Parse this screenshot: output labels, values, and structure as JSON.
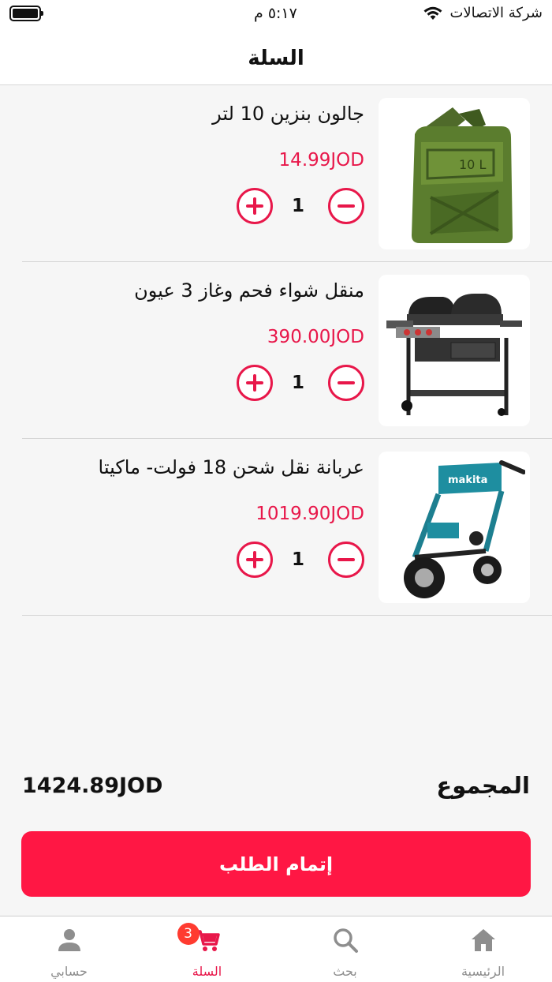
{
  "status_bar": {
    "carrier": "شركة الاتصالات",
    "time": "٥:١٧ م"
  },
  "header": {
    "title": "السلة"
  },
  "cart": {
    "items": [
      {
        "name": "جالون بنزين 10 لتر",
        "price": "14.99JOD",
        "quantity": "1",
        "image": "jerry-can-image"
      },
      {
        "name": "منقل شواء فحم وغاز 3 عيون",
        "price": "390.00JOD",
        "quantity": "1",
        "image": "grill-image"
      },
      {
        "name": "عربانة نقل شحن 18 فولت- ماكيتا",
        "price": "1019.90JOD",
        "quantity": "1",
        "image": "wheelbarrow-image"
      }
    ]
  },
  "summary": {
    "total_label": "المجموع",
    "total_value": "1424.89JOD"
  },
  "checkout": {
    "label": "إتمام الطلب"
  },
  "tab_bar": {
    "tabs": [
      {
        "label": "حسابي",
        "icon": "person-icon"
      },
      {
        "label": "السلة",
        "icon": "cart-icon",
        "badge": "3",
        "active": true
      },
      {
        "label": "بحث",
        "icon": "search-icon"
      },
      {
        "label": "الرئيسية",
        "icon": "home-icon"
      }
    ]
  },
  "colors": {
    "accent": "#e8174a",
    "button": "#ff1744",
    "badge": "#ff3b30",
    "inactive": "#8e8e8e"
  }
}
